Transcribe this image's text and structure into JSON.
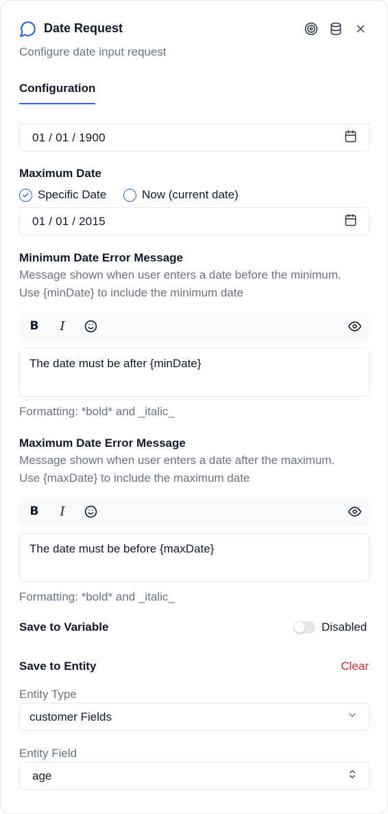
{
  "header": {
    "title": "Date Request",
    "subtitle": "Configure date input request",
    "icons": [
      "chat-icon",
      "target-icon",
      "database-icon",
      "close-icon"
    ]
  },
  "tabs": [
    {
      "label": "Configuration",
      "active": true
    }
  ],
  "minimum_date": {
    "value": "01 / 01 / 1900"
  },
  "maximum_date": {
    "label": "Maximum Date",
    "options": [
      {
        "label": "Specific Date",
        "selected": true
      },
      {
        "label": "Now (current date)",
        "selected": false
      }
    ],
    "value": "01 / 01 / 2015"
  },
  "min_error": {
    "label": "Minimum Date Error Message",
    "help_line1": "Message shown when user enters a date before the minimum.",
    "help_line2": "Use {minDate} to include the minimum date",
    "text": "The date must be after {minDate}",
    "formatting": "Formatting: *bold* and _italic_"
  },
  "max_error": {
    "label": "Maximum Date Error Message",
    "help_line1": "Message shown when user enters a date after the maximum.",
    "help_line2": "Use {maxDate} to include the maximum date",
    "text": "The date must be before {maxDate}",
    "formatting": "Formatting: *bold* and _italic_"
  },
  "toolbar": {
    "bold": "B",
    "italic": "I"
  },
  "save_variable": {
    "label": "Save to Variable",
    "status": "Disabled",
    "enabled": false
  },
  "save_entity": {
    "label": "Save to Entity",
    "clear": "Clear",
    "entity_type_label": "Entity Type",
    "entity_type_value": "customer Fields",
    "entity_field_label": "Entity Field",
    "entity_field_value": "age"
  },
  "colors": {
    "accent": "#2563eb",
    "danger": "#dc2626",
    "muted": "#6b7280"
  }
}
